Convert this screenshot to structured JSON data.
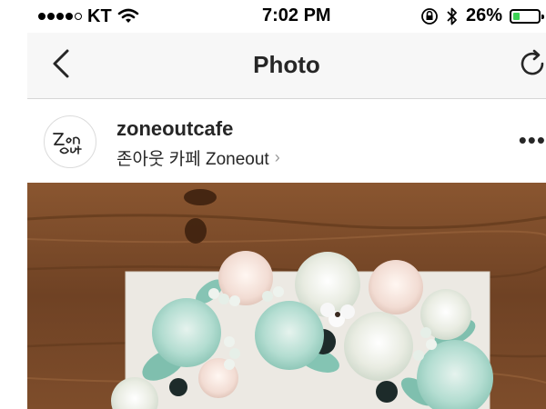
{
  "status_bar": {
    "carrier": "KT",
    "time": "7:02 PM",
    "battery": "26%",
    "battery_level": 0.26,
    "signal_bars_filled": 4,
    "signal_bars_total": 5,
    "icons": [
      "wifi-icon",
      "orientation-lock-icon",
      "bluetooth-icon",
      "battery-icon"
    ]
  },
  "nav": {
    "title": "Photo",
    "back_icon": "chevron-left-icon",
    "refresh_icon": "refresh-icon"
  },
  "post": {
    "username": "zoneoutcafe",
    "location": "존아웃 카페 Zoneout",
    "location_chevron": "›",
    "more": "•••",
    "avatar_text": "Zon Out"
  },
  "colors": {
    "battery_green": "#3cd255",
    "nav_background": "#f7f7f7",
    "wood": "#7a4a2a",
    "mint": "#9fd3c4",
    "cream": "#efe9dc"
  }
}
